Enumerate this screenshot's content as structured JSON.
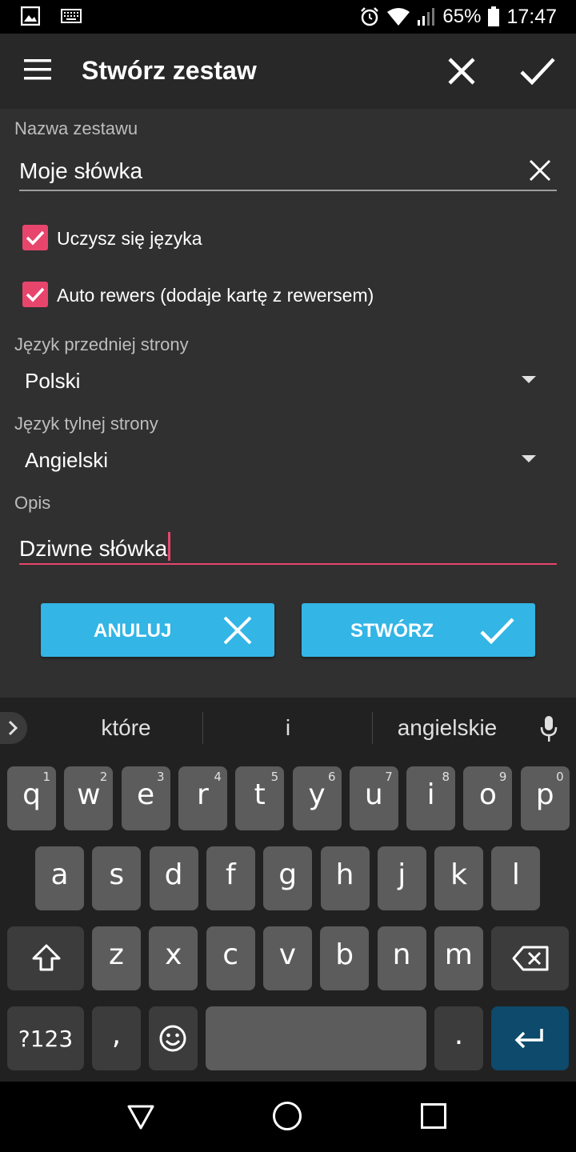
{
  "status": {
    "battery": "65%",
    "time": "17:47"
  },
  "appbar": {
    "title": "Stwórz zestaw"
  },
  "form": {
    "name_label": "Nazwa zestawu",
    "name_value": "Moje słówka",
    "learn_language_label": "Uczysz się języka",
    "learn_language_checked": true,
    "auto_reverse_label": "Auto rewers (dodaje kartę z rewersem)",
    "auto_reverse_checked": true,
    "front_language_label": "Język przedniej strony",
    "front_language_value": "Polski",
    "back_language_label": "Język tylnej strony",
    "back_language_value": "Angielski",
    "description_label": "Opis",
    "description_value": "Dziwne słówka"
  },
  "buttons": {
    "cancel": "ANULUJ",
    "create": "STWÓRZ"
  },
  "keyboard": {
    "suggestions": [
      "które",
      "i",
      "angielskie"
    ],
    "row1": [
      {
        "k": "q",
        "h": "1"
      },
      {
        "k": "w",
        "h": "2"
      },
      {
        "k": "e",
        "h": "3"
      },
      {
        "k": "r",
        "h": "4"
      },
      {
        "k": "t",
        "h": "5"
      },
      {
        "k": "y",
        "h": "6"
      },
      {
        "k": "u",
        "h": "7"
      },
      {
        "k": "i",
        "h": "8"
      },
      {
        "k": "o",
        "h": "9"
      },
      {
        "k": "p",
        "h": "0"
      }
    ],
    "row2": [
      "a",
      "s",
      "d",
      "f",
      "g",
      "h",
      "j",
      "k",
      "l"
    ],
    "row3": [
      "z",
      "x",
      "c",
      "v",
      "b",
      "n",
      "m"
    ],
    "symbols_label": "?123",
    "comma": ",",
    "period": "."
  },
  "colors": {
    "accent": "#e8456d",
    "button": "#33b5e5",
    "background": "#303030",
    "appbar": "#282828"
  }
}
